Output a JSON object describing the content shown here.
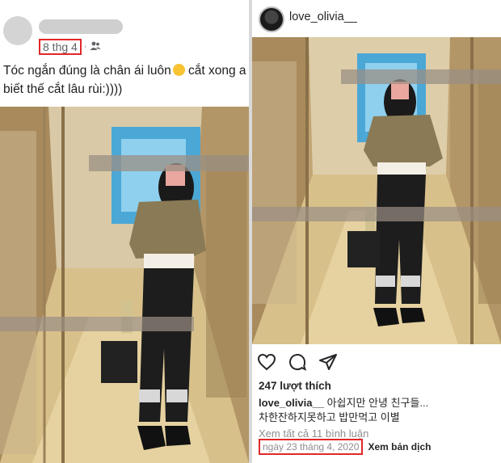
{
  "facebook": {
    "date_label": "8 thg 4",
    "caption_line1": "Tóc ngắn đúng là chân ái luôn",
    "caption_line1b": " cắt xong a",
    "caption_line2": "biết thế cắt lâu rùi:))))",
    "icons": [
      "avatar",
      "friends-icon",
      "grinning-emoji-icon"
    ]
  },
  "instagram": {
    "username": "love_olivia__",
    "likes": "247 lượt thích",
    "caption_user": "love_olivia__",
    "caption_text": " 아쉽지만 안녕 친구들...",
    "caption_line2": "차한잔하지못하고 밥만먹고 이별",
    "view_comments": "Xem tất cả 11 bình luận",
    "date": "ngày 23 tháng 4, 2020",
    "translate": "Xem bản dịch",
    "icons": [
      "heart-icon",
      "comment-icon",
      "share-icon"
    ]
  },
  "colors": {
    "highlight_box": "#e0282b",
    "meta_text": "#5f6368",
    "muted_text": "#8e8e8e"
  }
}
